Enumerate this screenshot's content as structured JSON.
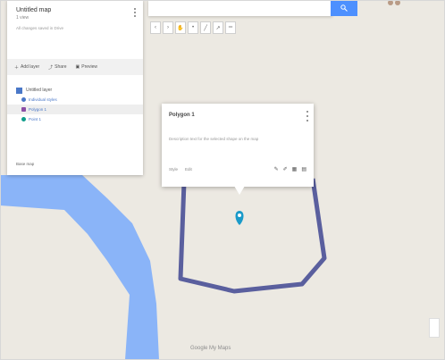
{
  "panel": {
    "title": "Untitled map",
    "subtitle": "1 view",
    "meta": "All changes saved in Drive",
    "actions": [
      {
        "icon": "add-layer-icon",
        "label": "Add layer"
      },
      {
        "icon": "share-icon",
        "label": "Share"
      },
      {
        "icon": "preview-icon",
        "label": "Preview"
      }
    ],
    "layer": {
      "name": "Untitled layer",
      "items": [
        {
          "label": "Individual styles",
          "color": "#4a78c8",
          "selected": false
        },
        {
          "label": "Polygon 1",
          "color": "#8b4ea6",
          "selected": true
        },
        {
          "label": "Point 1",
          "color": "#0f9d8a",
          "selected": false
        }
      ]
    },
    "basemap_label": "Base map"
  },
  "toolbar": {
    "tools": [
      "undo-icon",
      "redo-icon",
      "hand-icon",
      "marker-icon",
      "line-icon",
      "route-icon",
      "ruler-icon"
    ]
  },
  "popup": {
    "title": "Polygon 1",
    "description": "Description text for the selected shape on the map",
    "footer_left": "Style",
    "footer_right": "Edit",
    "tools": [
      "paint-icon",
      "edit-icon",
      "photo-icon",
      "delete-icon"
    ]
  },
  "map": {
    "watermark": "Google My Maps",
    "colors": {
      "water": "#8ab4f8",
      "polygon": "#5a5f9e",
      "pin": "#1a9ac9",
      "land": "#ece9e2"
    }
  }
}
